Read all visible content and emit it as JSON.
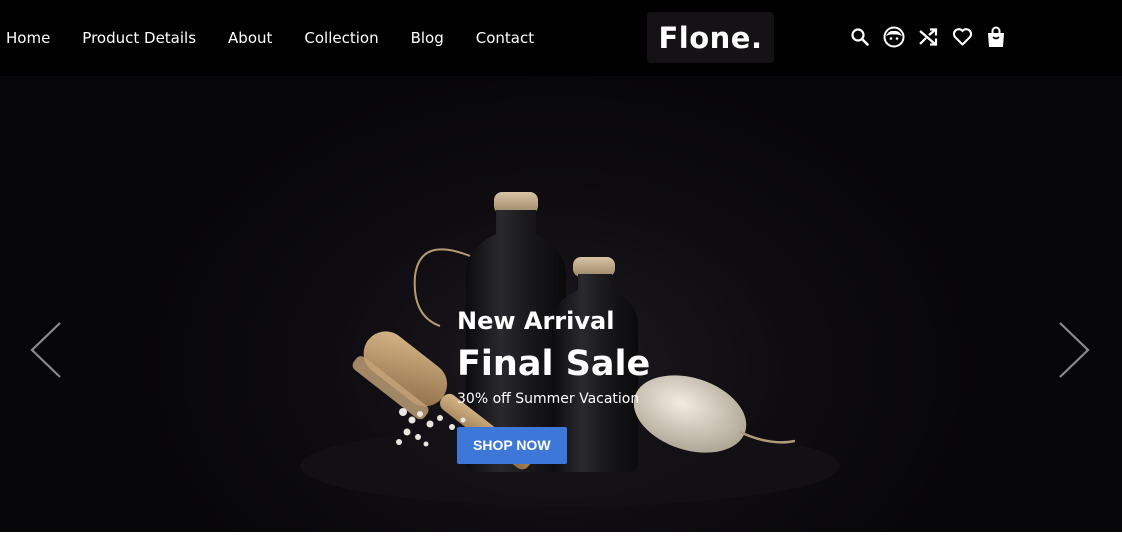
{
  "header": {
    "nav": [
      "Home",
      "Product Details",
      "About",
      "Collection",
      "Blog",
      "Contact"
    ],
    "logo": "Flone.",
    "icons": [
      "search-icon",
      "account-icon",
      "compare-shuffle-icon",
      "wishlist-heart-icon",
      "cart-bag-icon"
    ]
  },
  "hero": {
    "subtitle": "New Arrival",
    "title": "Final Sale",
    "description": "30% off Summer Vacation",
    "button_label": "SHOP NOW",
    "accent_color": "#3d78d8",
    "prev_icon": "chevron-left-icon",
    "next_icon": "chevron-right-icon"
  }
}
